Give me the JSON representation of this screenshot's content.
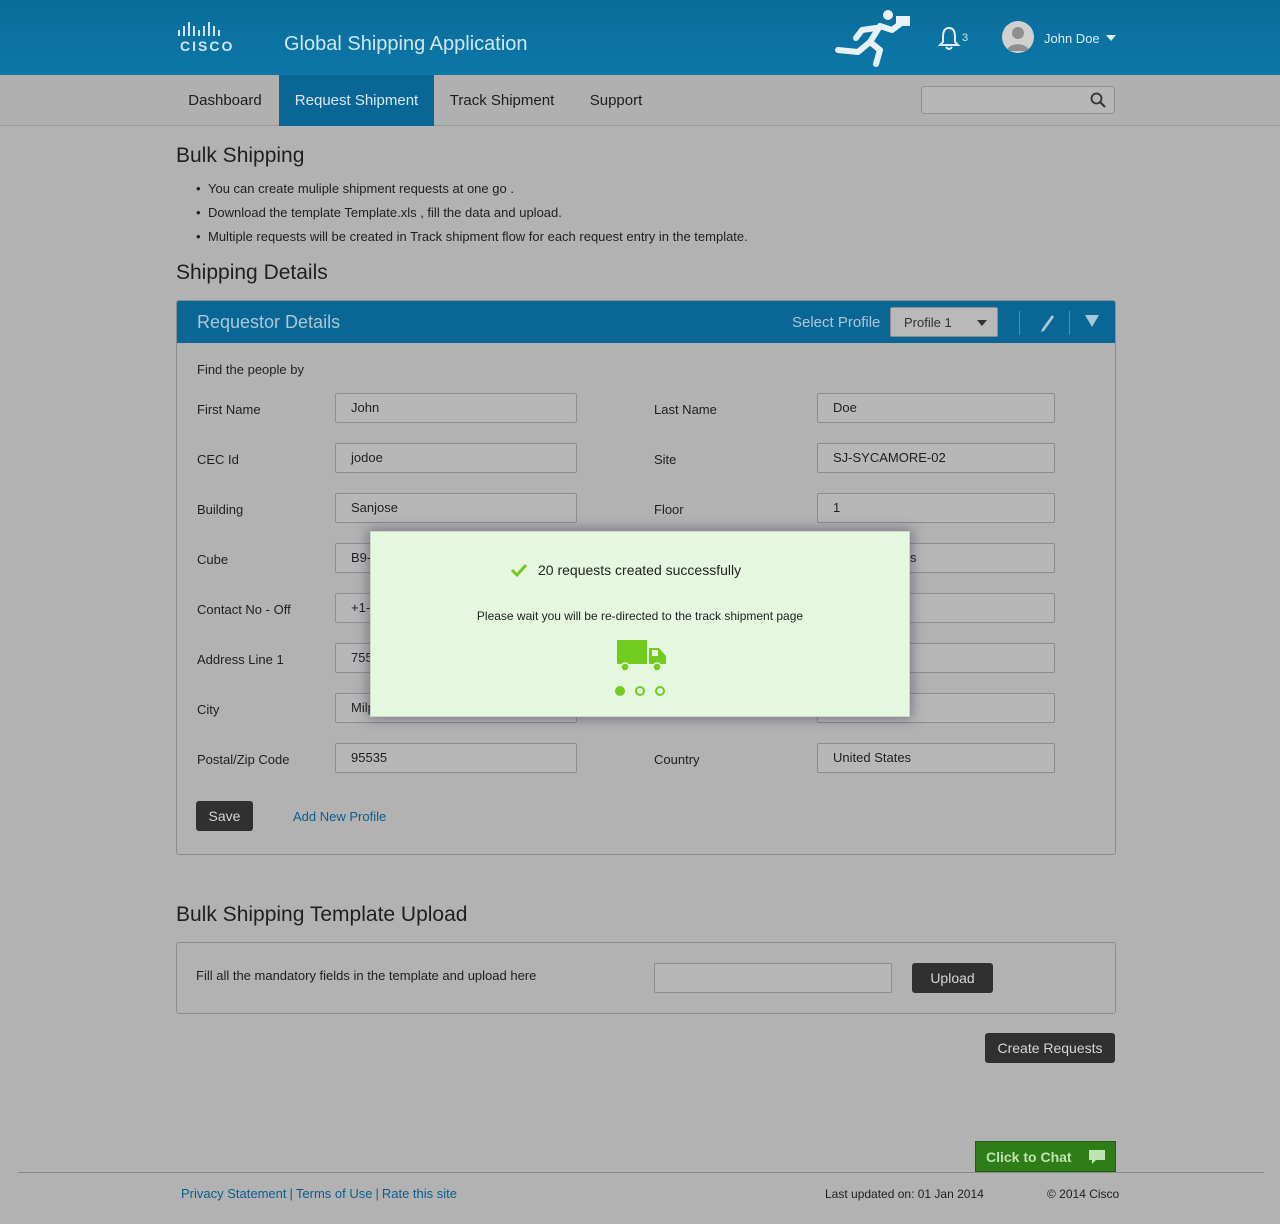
{
  "header": {
    "brand": "CISCO",
    "app_title": "Global Shipping Application",
    "notification_count": "3",
    "user_name": "John Doe"
  },
  "nav": {
    "tabs": [
      {
        "label": "Dashboard"
      },
      {
        "label": "Request Shipment",
        "active": true
      },
      {
        "label": "Track Shipment"
      },
      {
        "label": "Support"
      }
    ],
    "search_placeholder": ""
  },
  "bulk": {
    "title": "Bulk Shipping",
    "bullets": [
      "You can create muliple shipment requests at one go .",
      "Download the template Template.xls , fill the data and upload.",
      "Multiple requests will be created in Track shipment flow for each request entry in the template."
    ]
  },
  "shipping": {
    "title": "Shipping Details",
    "panel_title": "Requestor Details",
    "select_profile_label": "Select Profile",
    "profile_value": "Profile 1",
    "find_by": "Find the people by",
    "fields": {
      "first_name": {
        "label": "First Name",
        "value": "John"
      },
      "last_name": {
        "label": "Last Name",
        "value": "Doe"
      },
      "cec_id": {
        "label": "CEC Id",
        "value": "jodoe"
      },
      "site": {
        "label": "Site",
        "value": "SJ-SYCAMORE-02"
      },
      "building": {
        "label": "Building",
        "value": "Sanjose"
      },
      "floor": {
        "label": "Floor",
        "value": "1"
      },
      "cube": {
        "label": "Cube",
        "value": "B9-",
        "right_value": "s"
      },
      "contact": {
        "label": "Contact No - Off",
        "value": "+1-"
      },
      "address1": {
        "label": "Address Line 1",
        "value": "755"
      },
      "city": {
        "label": "City",
        "value": "Milp"
      },
      "postal": {
        "label": "Postal/Zip Code",
        "value": "95535"
      },
      "country": {
        "label": "Country",
        "value": "United States"
      }
    },
    "save_label": "Save",
    "add_profile_label": "Add New Profile"
  },
  "upload": {
    "title": "Bulk Shipping Template Upload",
    "instruction": "Fill all the mandatory fields in the template and upload here",
    "file_value": "",
    "upload_label": "Upload",
    "create_label": "Create Requests"
  },
  "chat": {
    "label": "Click to Chat"
  },
  "footer": {
    "links": [
      "Privacy Statement",
      "Terms of Use",
      "Rate this site"
    ],
    "separator": "|",
    "updated": "Last updated on: 01 Jan 2014",
    "copyright": "© 2014 Cisco"
  },
  "modal": {
    "title": "20 requests created successfully",
    "message": "Please wait you will be re-directed to the track shipment page",
    "progress_step": 1,
    "progress_total": 3
  },
  "colors": {
    "header_blue": "#0a6d9a",
    "active_tab": "#0a6694",
    "success_green": "#71cc1d",
    "chat_green": "#2f7d18",
    "modal_bg": "#e6f7e0"
  }
}
